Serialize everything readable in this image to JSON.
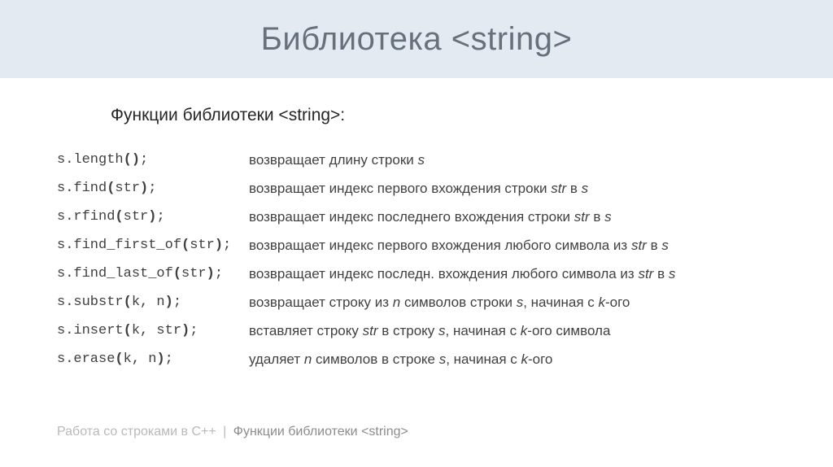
{
  "title": "Библиотека <string>",
  "subtitle": "Функции библиотеки <string>:",
  "rows": [
    {
      "code": "s.length();",
      "desc": "возвращает длину строки s"
    },
    {
      "code": "s.find(str);",
      "desc": "возвращает индекс первого вхождения строки str в s"
    },
    {
      "code": "s.rfind(str);",
      "desc": "возвращает индекс последнего вхождения строки str в s"
    },
    {
      "code": "s.find_first_of(str);",
      "desc": "возвращает индекс первого вхождения любого символа из str в s"
    },
    {
      "code": "s.find_last_of(str);",
      "desc": "возвращает индекс последн. вхождения любого символа из str в s"
    },
    {
      "code": "s.substr(k, n);",
      "desc": "возвращает строку из n символов строки s, начиная с k-ого"
    },
    {
      "code": "s.insert(k, str);",
      "desc": "вставляет строку str в строку s, начиная с k-ого символа"
    },
    {
      "code": "s.erase(k, n);",
      "desc": "удаляет n символов в строке s, начиная с k-ого"
    }
  ],
  "footer": {
    "left": "Работа со строками в С++",
    "right": "Функции библиотеки <string>"
  }
}
